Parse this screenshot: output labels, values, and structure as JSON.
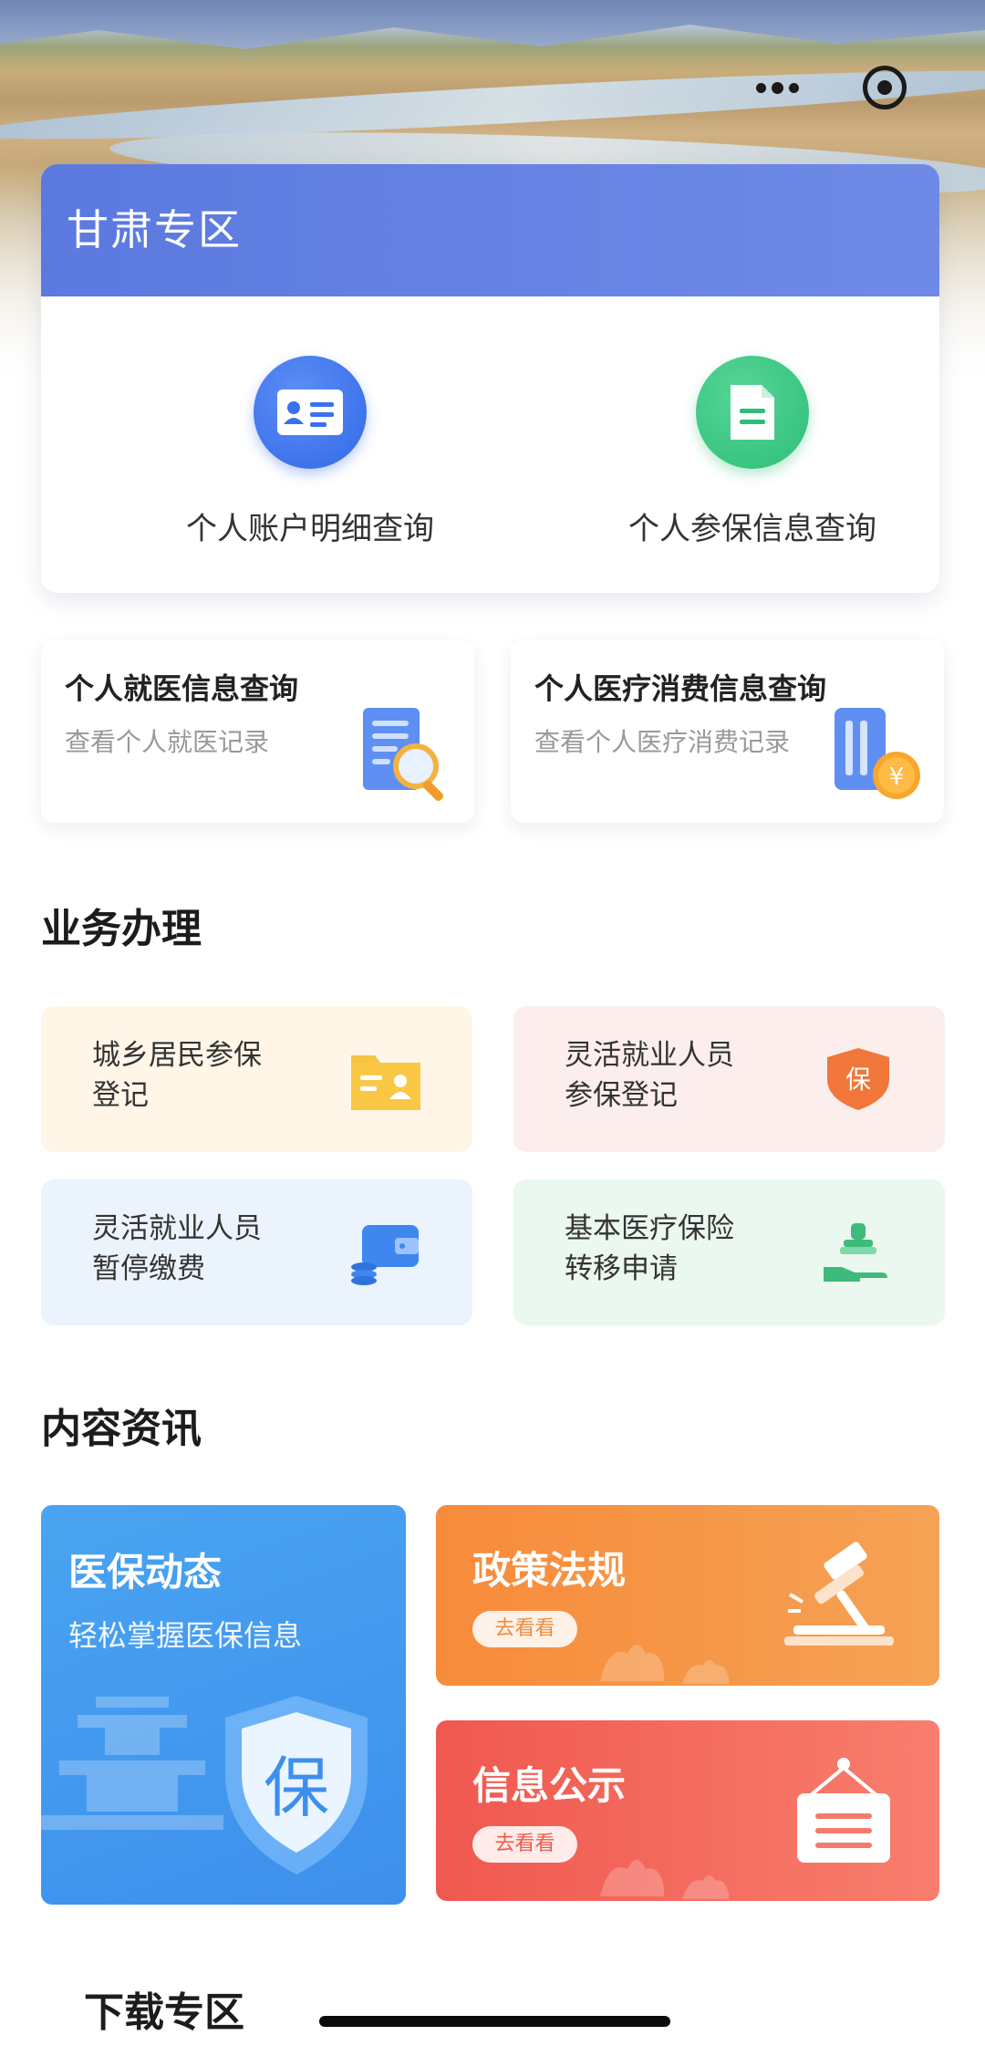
{
  "gansu": {
    "title": "甘肃专区",
    "items": [
      {
        "label": "个人账户明细查询",
        "icon": "id-card-icon"
      },
      {
        "label": "个人参保信息查询",
        "icon": "document-icon"
      }
    ]
  },
  "info_cards": [
    {
      "title": "个人就医信息查询",
      "subtitle": "查看个人就医记录",
      "icon": "magnifier-doc-icon"
    },
    {
      "title": "个人医疗消费信息查询",
      "subtitle": "查看个人医疗消费记录",
      "icon": "yuan-card-icon"
    }
  ],
  "business": {
    "title": "业务办理",
    "items": [
      {
        "line1": "城乡居民参保",
        "line2": "登记",
        "icon": "folder-person-icon",
        "color": "#fff6e8"
      },
      {
        "line1": "灵活就业人员",
        "line2": "参保登记",
        "icon": "shield-bao-icon",
        "color": "#fdeeee"
      },
      {
        "line1": "灵活就业人员",
        "line2": "暂停缴费",
        "icon": "wallet-coins-icon",
        "color": "#ebf3fd"
      },
      {
        "line1": "基本医疗保险",
        "line2": "转移申请",
        "icon": "hand-stamp-icon",
        "color": "#eaf8ef"
      }
    ]
  },
  "content": {
    "title": "内容资讯",
    "featured": {
      "title": "医保动态",
      "subtitle": "轻松掌握医保信息",
      "badge": "保"
    },
    "cards": [
      {
        "title": "政策法规",
        "button": "去看看",
        "icon": "gavel-icon"
      },
      {
        "title": "信息公示",
        "button": "去看看",
        "icon": "notice-board-icon"
      }
    ]
  },
  "download": {
    "title": "下载专区"
  },
  "colors": {
    "header_blue": "#5b79df",
    "orange": "#f78b3a",
    "red": "#f0584f",
    "blue_card": "#3d8fec"
  }
}
